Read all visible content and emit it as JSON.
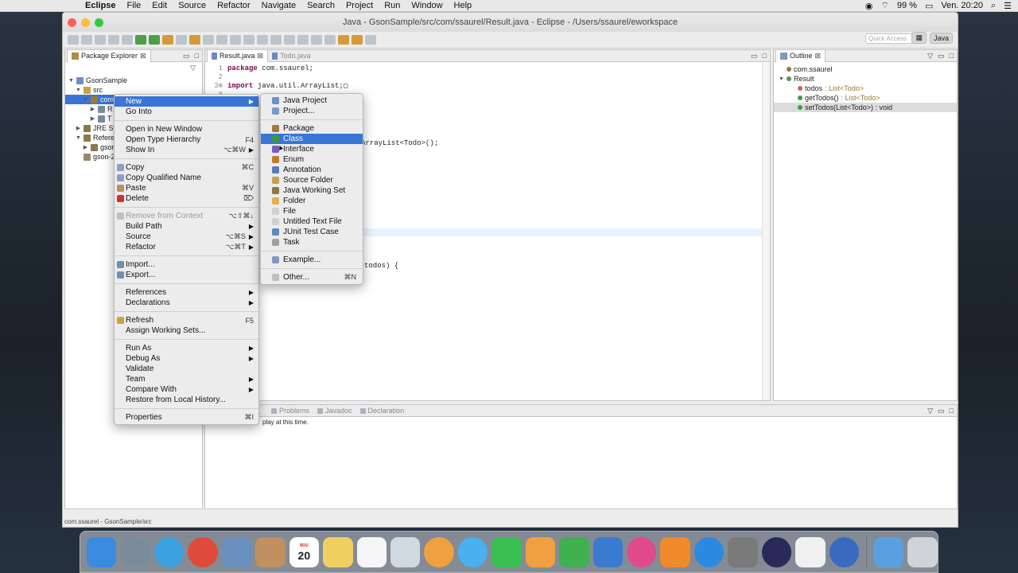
{
  "menubar": {
    "app": "Eclipse",
    "items": [
      "File",
      "Edit",
      "Source",
      "Refactor",
      "Navigate",
      "Search",
      "Project",
      "Run",
      "Window",
      "Help"
    ],
    "battery": "99 %",
    "clock": "Ven. 20:20"
  },
  "window": {
    "title": "Java - GsonSample/src/com/ssaurel/Result.java - Eclipse - /Users/ssaurel/eworkspace",
    "quick_access_placeholder": "Quick Access",
    "perspective_label": "Java"
  },
  "package_explorer": {
    "tab": "Package Explorer",
    "tree": [
      {
        "label": "GsonSample",
        "indent": 0,
        "twisty": "▼",
        "icon": "#6b8fc9"
      },
      {
        "label": "src",
        "indent": 1,
        "twisty": "▼",
        "icon": "#c9a04a"
      },
      {
        "label": "com.",
        "indent": 2,
        "twisty": "▼",
        "icon": "#a07a3a",
        "selected": true
      },
      {
        "label": "R",
        "indent": 3,
        "twisty": "▶",
        "icon": "#7a8a9a"
      },
      {
        "label": "T",
        "indent": 3,
        "twisty": "▶",
        "icon": "#7a8a9a"
      },
      {
        "label": "JRE Sys",
        "indent": 1,
        "twisty": "▶",
        "icon": "#8a7a4a"
      },
      {
        "label": "Referen",
        "indent": 1,
        "twisty": "▼",
        "icon": "#8a7a4a"
      },
      {
        "label": "gson",
        "indent": 2,
        "twisty": "▶",
        "icon": "#8a7a4a"
      },
      {
        "label": "gson-2",
        "indent": 1,
        "twisty": "",
        "icon": "#9a8a6a"
      }
    ]
  },
  "editor": {
    "tabs": [
      "Result.java",
      "Todo.java"
    ],
    "lines": [
      {
        "n": "1",
        "text": "package com.ssaurel;"
      },
      {
        "n": "2",
        "text": ""
      },
      {
        "n": "3⊕",
        "text": "import java.util.ArrayList;▢"
      },
      {
        "n": "8",
        "text": ""
      }
    ],
    "fragment_line_a": "ArrayList<Todo>();",
    "fragment_line_b": "todos) {"
  },
  "outline": {
    "tab": "Outline",
    "items": [
      {
        "label": "com.ssaurel",
        "type": "",
        "indent": 0,
        "icon": "#8a7a4a"
      },
      {
        "label": "Result",
        "type": "",
        "indent": 0,
        "icon": "#4a9a4a",
        "twisty": "▼"
      },
      {
        "label": "todos",
        "type": " : List<Todo>",
        "indent": 1,
        "icon": "#d06060"
      },
      {
        "label": "getTodos()",
        "type": " : List<Todo>",
        "indent": 1,
        "icon": "#3aa03a"
      },
      {
        "label": "setTodos(List<Todo>) : void",
        "type": "",
        "indent": 1,
        "icon": "#3aa03a",
        "selected": true
      }
    ]
  },
  "bottom_panel": {
    "tabs": [
      "Problems",
      "Javadoc",
      "Declaration"
    ],
    "message": "play at this time."
  },
  "context_menu": {
    "items": [
      {
        "label": "New",
        "arrow": true,
        "highlight": true
      },
      {
        "label": "Go Into"
      },
      {
        "sep": true
      },
      {
        "label": "Open in New Window"
      },
      {
        "label": "Open Type Hierarchy",
        "shortcut": "F4"
      },
      {
        "label": "Show In",
        "shortcut": "⌥⌘W",
        "arrow": true
      },
      {
        "sep": true
      },
      {
        "label": "Copy",
        "shortcut": "⌘C",
        "icon": "#8aa0c0"
      },
      {
        "label": "Copy Qualified Name",
        "icon": "#8aa0c0"
      },
      {
        "label": "Paste",
        "shortcut": "⌘V",
        "icon": "#b89060"
      },
      {
        "label": "Delete",
        "shortcut": "⌦",
        "icon": "#d03030"
      },
      {
        "sep": true
      },
      {
        "label": "Remove from Context",
        "shortcut": "⌥⇧⌘↓",
        "disabled": true,
        "icon": "#c0c0c0"
      },
      {
        "label": "Build Path",
        "arrow": true
      },
      {
        "label": "Source",
        "shortcut": "⌥⌘S",
        "arrow": true
      },
      {
        "label": "Refactor",
        "shortcut": "⌥⌘T",
        "arrow": true
      },
      {
        "sep": true
      },
      {
        "label": "Import...",
        "icon": "#7090b0"
      },
      {
        "label": "Export...",
        "icon": "#7090b0"
      },
      {
        "sep": true
      },
      {
        "label": "References",
        "arrow": true
      },
      {
        "label": "Declarations",
        "arrow": true
      },
      {
        "sep": true
      },
      {
        "label": "Refresh",
        "shortcut": "F5",
        "icon": "#d0a040"
      },
      {
        "label": "Assign Working Sets..."
      },
      {
        "sep": true
      },
      {
        "label": "Run As",
        "arrow": true
      },
      {
        "label": "Debug As",
        "arrow": true
      },
      {
        "label": "Validate"
      },
      {
        "label": "Team",
        "arrow": true
      },
      {
        "label": "Compare With",
        "arrow": true
      },
      {
        "label": "Restore from Local History..."
      },
      {
        "sep": true
      },
      {
        "label": "Properties",
        "shortcut": "⌘I"
      }
    ]
  },
  "new_submenu": {
    "items": [
      {
        "label": "Java Project",
        "icon": "#6b8fc9"
      },
      {
        "label": "Project...",
        "icon": "#7a9ac0"
      },
      {
        "sep": true
      },
      {
        "label": "Package",
        "icon": "#a07a3a"
      },
      {
        "label": "Class",
        "icon": "#3a9a3a",
        "highlight": true
      },
      {
        "label": "Interface",
        "icon": "#7a5ac0"
      },
      {
        "label": "Enum",
        "icon": "#c07a2a"
      },
      {
        "label": "Annotation",
        "icon": "#5a7ac0"
      },
      {
        "label": "Source Folder",
        "icon": "#c9a04a"
      },
      {
        "label": "Java Working Set",
        "icon": "#8a7a4a"
      },
      {
        "label": "Folder",
        "icon": "#e0b050"
      },
      {
        "label": "File",
        "icon": "#d0d0d0"
      },
      {
        "label": "Untitled Text File",
        "icon": "#d0d0d0"
      },
      {
        "label": "JUnit Test Case",
        "icon": "#5a8ac0"
      },
      {
        "label": "Task",
        "icon": "#a0a0a0"
      },
      {
        "sep": true
      },
      {
        "label": "Example...",
        "icon": "#7a9ac0"
      },
      {
        "sep": true
      },
      {
        "label": "Other...",
        "shortcut": "⌘N",
        "icon": "#c0c0c0"
      }
    ]
  },
  "statusbar": "com.ssaurel - GsonSample/src",
  "dock": {
    "calendar_month": "MAI",
    "calendar_day": "20",
    "items": [
      {
        "name": "finder-icon",
        "color": "#3a8ae0"
      },
      {
        "name": "launchpad-icon",
        "color": "#7a8a9a",
        "round": true
      },
      {
        "name": "safari-icon",
        "color": "#3aa0e0",
        "round": true
      },
      {
        "name": "chrome-icon",
        "color": "#e04a3a",
        "round": true
      },
      {
        "name": "mail-bird-icon",
        "color": "#6a90c0"
      },
      {
        "name": "contacts-icon",
        "color": "#c09060"
      },
      {
        "name": "calendar-icon",
        "color": "#ffffff",
        "calendar": true
      },
      {
        "name": "notes-icon",
        "color": "#f0d060"
      },
      {
        "name": "reminders-icon",
        "color": "#f5f5f5"
      },
      {
        "name": "preview-icon",
        "color": "#d0d8e0"
      },
      {
        "name": "photos-icon",
        "color": "#f0a040",
        "round": true
      },
      {
        "name": "messages-icon",
        "color": "#4ab0f0",
        "round": true
      },
      {
        "name": "facetime-icon",
        "color": "#3ac050"
      },
      {
        "name": "pages-icon",
        "color": "#f0a040"
      },
      {
        "name": "numbers-icon",
        "color": "#40b050"
      },
      {
        "name": "keynote-icon",
        "color": "#3a7ad0"
      },
      {
        "name": "itunes-icon",
        "color": "#e04a8a",
        "round": true
      },
      {
        "name": "ibooks-icon",
        "color": "#f08a2a"
      },
      {
        "name": "app-store-icon",
        "color": "#2a8ae0",
        "round": true
      },
      {
        "name": "system-prefs-icon",
        "color": "#7a7a7a"
      },
      {
        "name": "eclipse-icon",
        "color": "#2a2a5a",
        "round": true
      },
      {
        "name": "textedit-icon",
        "color": "#f0f0f0"
      },
      {
        "name": "quicktime-icon",
        "color": "#3a6ac0",
        "round": true
      },
      {
        "name": "downloads-folder-icon",
        "color": "#5aa0e0",
        "sepBefore": true
      },
      {
        "name": "trash-icon",
        "color": "#d0d4d8"
      }
    ]
  }
}
